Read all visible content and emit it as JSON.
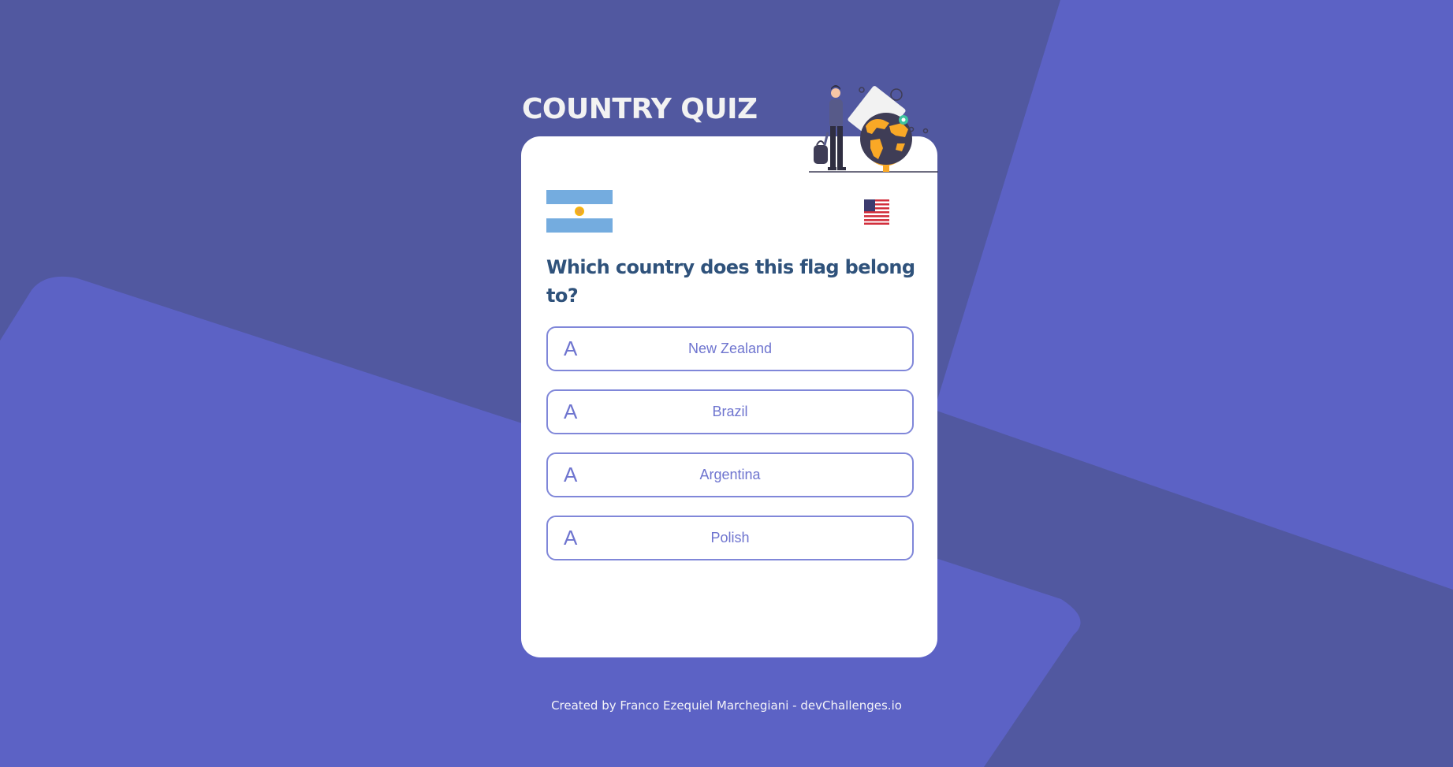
{
  "app": {
    "title": "COUNTRY QUIZ"
  },
  "quiz": {
    "question": "Which country does this flag belong to?",
    "flag_icon": "argentina-flag-icon",
    "secondary_flag_icon": "usa-flag-icon",
    "options": [
      {
        "letter": "A",
        "label": "New Zealand"
      },
      {
        "letter": "A",
        "label": "Brazil"
      },
      {
        "letter": "A",
        "label": "Argentina"
      },
      {
        "letter": "A",
        "label": "Polish"
      }
    ]
  },
  "footer": {
    "text": "Created by Franco Ezequiel Marchegiani - devChallenges.io"
  },
  "colors": {
    "background_dark": "#5158a0",
    "background_light": "#5c62c5",
    "title": "#f2f2f2",
    "question": "#2f527b",
    "option_border": "#8087d9",
    "option_text": "#6e74cf"
  }
}
